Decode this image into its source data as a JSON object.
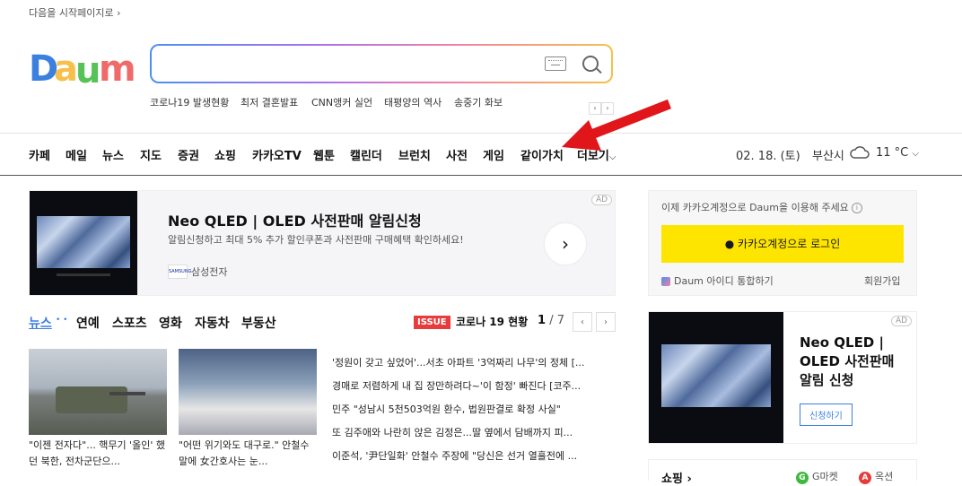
{
  "header": {
    "set_homepage": "다음을 시작페이지로",
    "logo_text": "Daum",
    "search": {
      "placeholder": "",
      "value": ""
    },
    "trending": [
      "코로나19 발생현황",
      "최저 결혼발표",
      "CNN앵커 실언",
      "태평양의 역사",
      "송중기 화보"
    ],
    "trend_prev": "‹",
    "trend_next": "›"
  },
  "nav": {
    "items": [
      "카페",
      "메일",
      "뉴스",
      "지도",
      "증권",
      "쇼핑",
      "카카오TV",
      "웹툰",
      "캘린더",
      "브런치",
      "사전",
      "게임",
      "같이가치",
      "더보기"
    ],
    "more_caret": "⌵",
    "date": "02. 18. (토)",
    "location": "부산시",
    "weather_icon": "cloud-icon",
    "temperature": "11 °C"
  },
  "ad_top": {
    "badge": "AD",
    "title": "Neo QLED | OLED 사전판매 알림신청",
    "description": "알림신청하고 최대 5% 추가 할인쿠폰과 사전판매 구매혜택 확인하세요!",
    "brand_logo": "SAMSUNG",
    "brand": "삼성전자",
    "go_arrow": "›"
  },
  "login_box": {
    "message": "이제 카카오계정으로 Daum을 이용해 주세요",
    "info": "i",
    "button": "카카오계정으로 로그인",
    "daum_id": "Daum 아이디 통합하기",
    "join": "회원가입"
  },
  "news_tabs": {
    "tabs": [
      "뉴스",
      "연예",
      "스포츠",
      "영화",
      "자동차",
      "부동산"
    ],
    "news_dots": "• •",
    "issue_badge": "ISSUE",
    "issue_title": "코로나 19 현황",
    "page_current": "1",
    "page_total": "/ 7",
    "prev": "‹",
    "next": "›"
  },
  "news": {
    "thumbs": [
      {
        "caption": "\"이젠 전자다\"... 핵무기 '올인' 했던 북한, 전차군단으..."
      },
      {
        "caption": "\"어떤 위기와도 대구로.\" 안철수 말에 女간호사는 눈..."
      }
    ],
    "headlines": [
      "'정원이 갖고 싶었어'...서초 아파트 '3억짜리 나무'의 정체 [...",
      "경매로 저렴하게 내 집 장만하려다~'이 함정' 빠진다 [코주...",
      "민주 \"성남시 5천503억원 환수, 법원판결로 확정 사실\"",
      "또 김주애와 나란히 앉은 김정은...딸 옆에서 담배까지 피...",
      "이준석, '尹단일화' 안철수 주장에 \"당신은 선거 열흘전에 ..."
    ]
  },
  "ad_side": {
    "badge": "AD",
    "title": "Neo QLED | OLED 사전판매 알림 신청",
    "button": "신청하기"
  },
  "shopping": {
    "title": "쇼핑 ›",
    "gmarket_icon": "G",
    "gmarket": "G마켓",
    "auction_icon": "A",
    "auction": "옥션"
  }
}
